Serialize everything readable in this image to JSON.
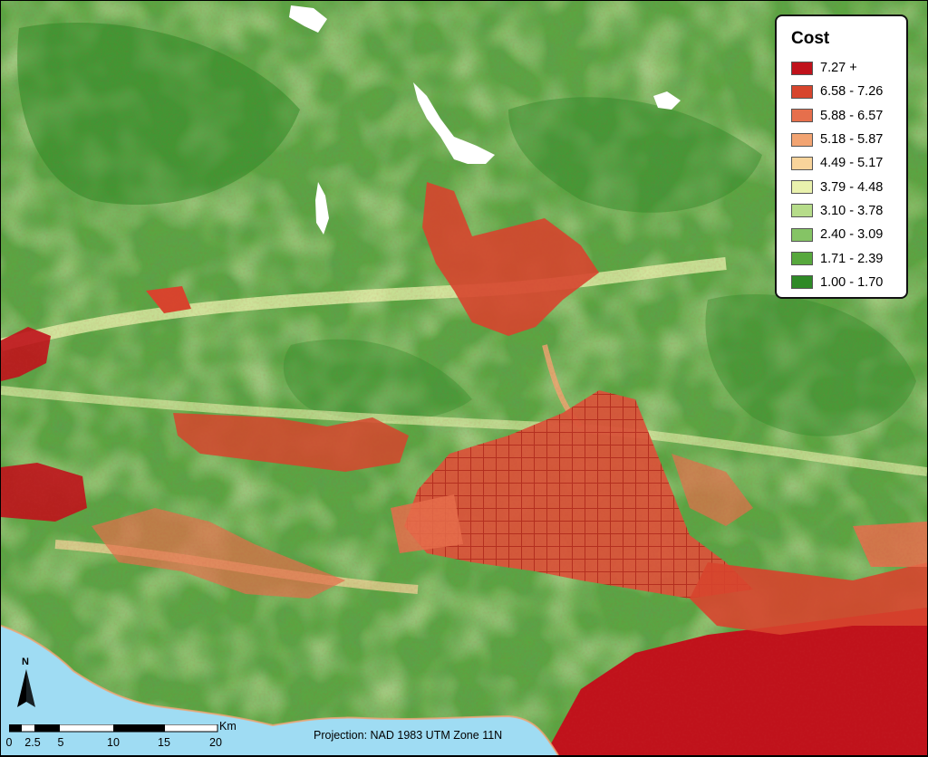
{
  "legend": {
    "title": "Cost",
    "items": [
      {
        "label": "7.27 +",
        "color": "#c0121b"
      },
      {
        "label": "6.58 - 7.26",
        "color": "#d7452d"
      },
      {
        "label": "5.88 - 6.57",
        "color": "#e66f4c"
      },
      {
        "label": "5.18 - 5.87",
        "color": "#f2a472"
      },
      {
        "label": "4.49 - 5.17",
        "color": "#f8d49b"
      },
      {
        "label": "3.79 - 4.48",
        "color": "#e9f1ad"
      },
      {
        "label": "3.10 - 3.78",
        "color": "#b6dc8a"
      },
      {
        "label": "2.40 - 3.09",
        "color": "#85c465"
      },
      {
        "label": "1.71 - 2.39",
        "color": "#57a83d"
      },
      {
        "label": "1.00 - 1.70",
        "color": "#2f8a27"
      }
    ]
  },
  "north_arrow": {
    "letter": "N"
  },
  "scale_bar": {
    "ticks": [
      "0",
      "2.5",
      "5",
      "10",
      "15",
      "20"
    ],
    "unit": "Km"
  },
  "projection": "Projection: NAD 1983 UTM Zone 11N",
  "colors": {
    "water": "#9fdcf3",
    "reservoir": "#ffffff"
  }
}
